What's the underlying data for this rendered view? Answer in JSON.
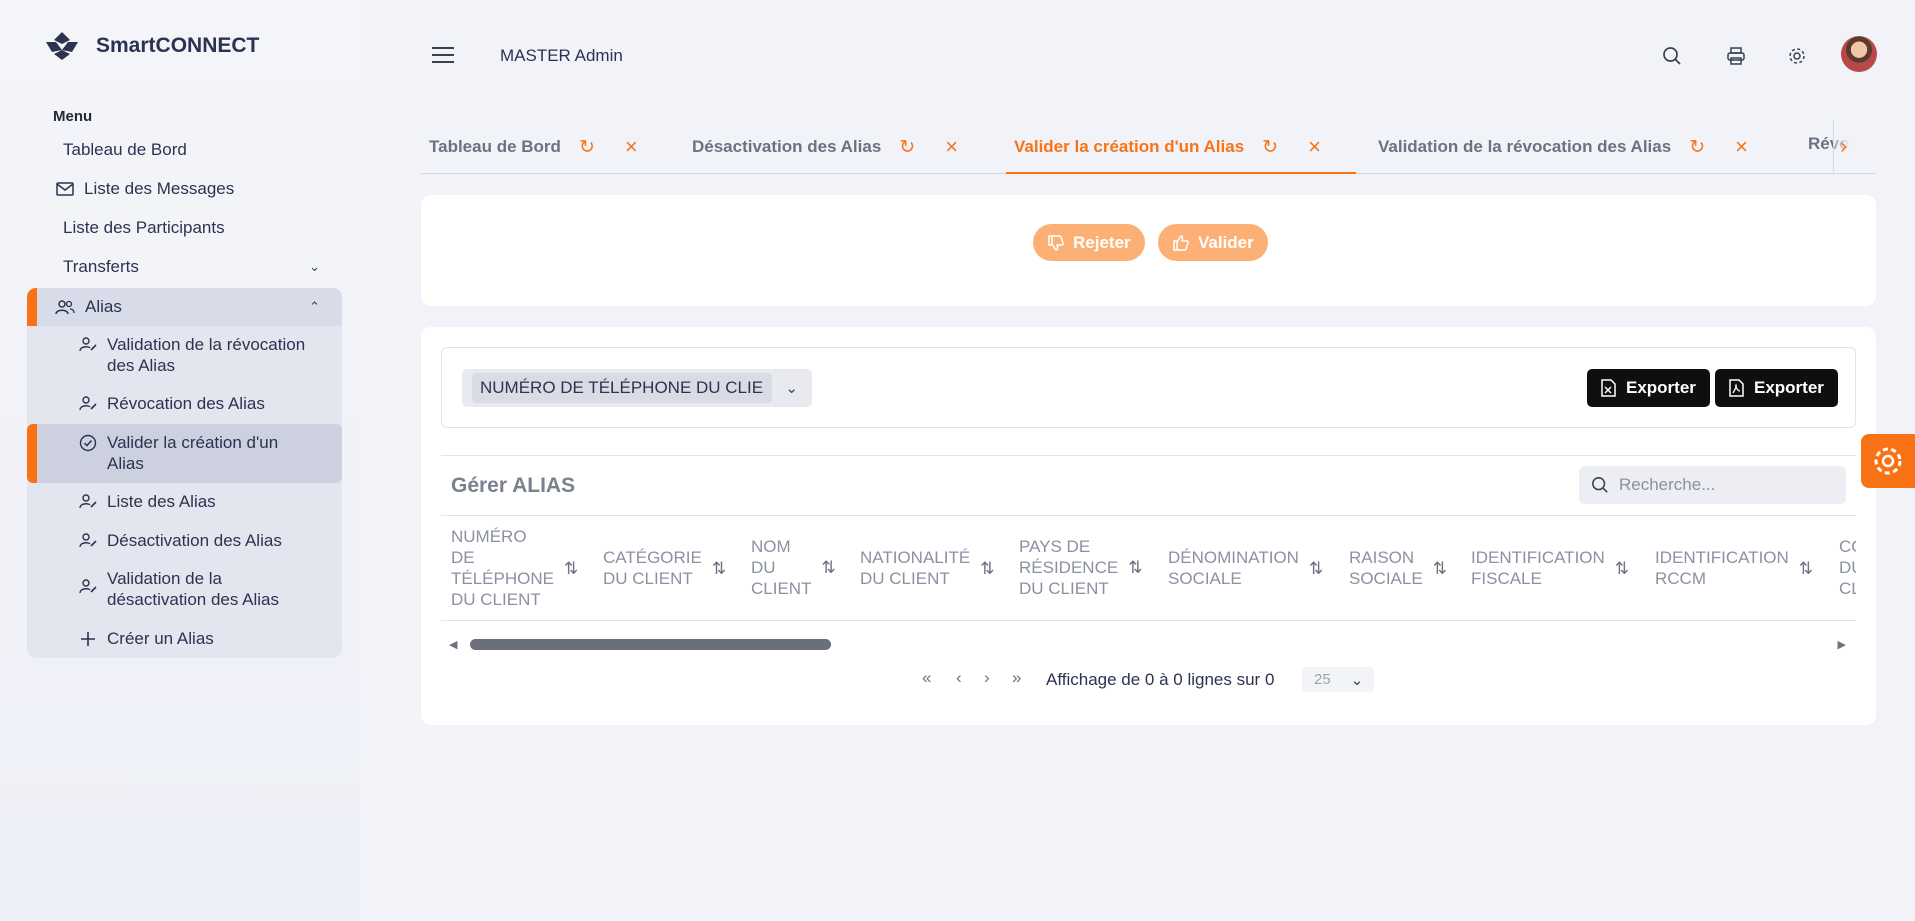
{
  "brand": {
    "name": "SmartCONNECT"
  },
  "sidebar": {
    "menu_label": "Menu",
    "items": [
      {
        "label": "Tableau de Bord",
        "icon": ""
      },
      {
        "label": "Liste des Messages",
        "icon": "mail-icon"
      },
      {
        "label": "Liste des Participants",
        "icon": ""
      },
      {
        "label": "Transferts",
        "icon": "chevron-down-icon"
      },
      {
        "label": "Alias",
        "icon": "users-icon"
      }
    ],
    "alias_items": [
      {
        "label": "Validation de la révocation des Alias",
        "icon": "user-edit-icon"
      },
      {
        "label": "Révocation des Alias",
        "icon": "user-edit-icon"
      },
      {
        "label": "Valider la création d'un Alias",
        "icon": "check-circle-icon"
      },
      {
        "label": "Liste des Alias",
        "icon": "user-edit-icon"
      },
      {
        "label": "Désactivation des Alias",
        "icon": "user-edit-icon"
      },
      {
        "label": "Validation de la désactivation des Alias",
        "icon": "user-edit-icon"
      },
      {
        "label": "Créer un Alias",
        "icon": "plus-icon"
      }
    ]
  },
  "header": {
    "user_role": "MASTER Admin",
    "icons": [
      "menu-icon",
      "search-icon",
      "print-icon",
      "settings-icon",
      "avatar"
    ]
  },
  "tabs": [
    {
      "label": "Tableau de Bord"
    },
    {
      "label": "Désactivation des Alias"
    },
    {
      "label": "Valider la création d'un Alias"
    },
    {
      "label": "Validation de la révocation des Alias"
    },
    {
      "label": "Révocat"
    }
  ],
  "actions": {
    "reject_label": "Rejeter",
    "validate_label": "Valider"
  },
  "toolbar": {
    "column_chip": "NUMÉRO DE TÉLÉPHONE DU CLIE",
    "export_excel_label": "Exporter",
    "export_pdf_label": "Exporter"
  },
  "grid": {
    "title": "Gérer ALIAS",
    "search_placeholder": "Recherche...",
    "columns": [
      [
        "NUMÉRO",
        "DE",
        "TÉLÉPHONE",
        "DU CLIENT"
      ],
      [
        "CATÉGORIE",
        "DU CLIENT"
      ],
      [
        "NOM",
        "DU",
        "CLIENT"
      ],
      [
        "NATIONALITÉ",
        "DU CLIENT"
      ],
      [
        "PAYS DE",
        "RÉSIDENCE",
        "DU CLIENT"
      ],
      [
        "DÉNOMINATION",
        "SOCIALE"
      ],
      [
        "RAISON",
        "SOCIALE"
      ],
      [
        "IDENTIFICATION",
        "FISCALE"
      ],
      [
        "IDENTIFICATION",
        "RCCM"
      ],
      [
        "CO",
        "DU",
        "CL"
      ]
    ]
  },
  "pagination": {
    "first": "«",
    "prev": "‹",
    "next": "›",
    "last": "»",
    "summary": "Affichage de 0 à 0 lignes sur 0",
    "page_size": "25"
  },
  "colors": {
    "accent": "#f97316",
    "accent_light": "#fdb076",
    "dark_button": "#0f0f10"
  }
}
